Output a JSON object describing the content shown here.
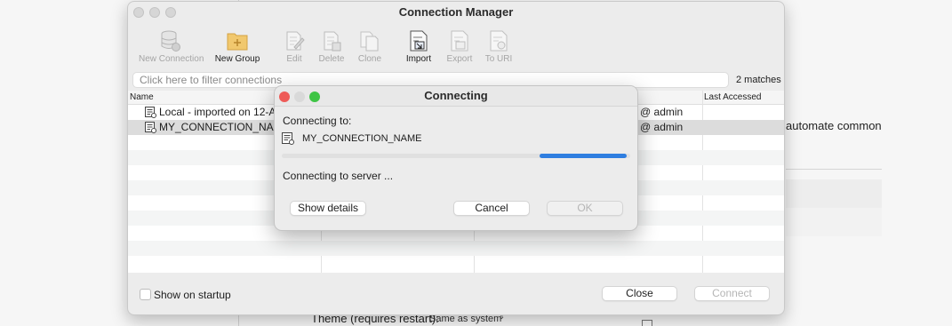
{
  "background": {
    "right_text": "automate common",
    "theme_label": "Theme (requires restart):",
    "theme_value": "Same as system"
  },
  "window": {
    "title": "Connection Manager",
    "toolbar": [
      {
        "label": "New Connection",
        "icon": "database-icon",
        "enabled": false
      },
      {
        "label": "New Group",
        "icon": "folder-plus-icon",
        "enabled": true
      },
      {
        "label": "Edit",
        "icon": "edit-icon",
        "enabled": false
      },
      {
        "label": "Delete",
        "icon": "delete-icon",
        "enabled": false
      },
      {
        "label": "Clone",
        "icon": "clone-icon",
        "enabled": false
      },
      {
        "label": "Import",
        "icon": "import-icon",
        "enabled": true
      },
      {
        "label": "Export",
        "icon": "export-icon",
        "enabled": false
      },
      {
        "label": "To URI",
        "icon": "uri-icon",
        "enabled": false
      }
    ],
    "filter_placeholder": "Click here to filter connections",
    "matches": "2 matches",
    "columns": [
      "Name",
      "Last Accessed"
    ],
    "rows": [
      {
        "name": "Local - imported on 12-Ap",
        "user": "@ admin"
      },
      {
        "name": "MY_CONNECTION_NAME",
        "user": "@ admin"
      }
    ],
    "show_on_startup": "Show on startup",
    "close_label": "Close",
    "connect_label": "Connect"
  },
  "dialog": {
    "title": "Connecting",
    "connecting_to_label": "Connecting to:",
    "connection_name": "MY_CONNECTION_NAME",
    "progress": 0.25,
    "status": "Connecting to server  ...",
    "show_details_label": "Show details",
    "cancel_label": "Cancel",
    "ok_label": "OK"
  },
  "colors": {
    "accent": "#2f7ee0",
    "close_dot": "#ee5b58",
    "min_dot": "#d9d9d9",
    "max_dot": "#3ec445"
  }
}
